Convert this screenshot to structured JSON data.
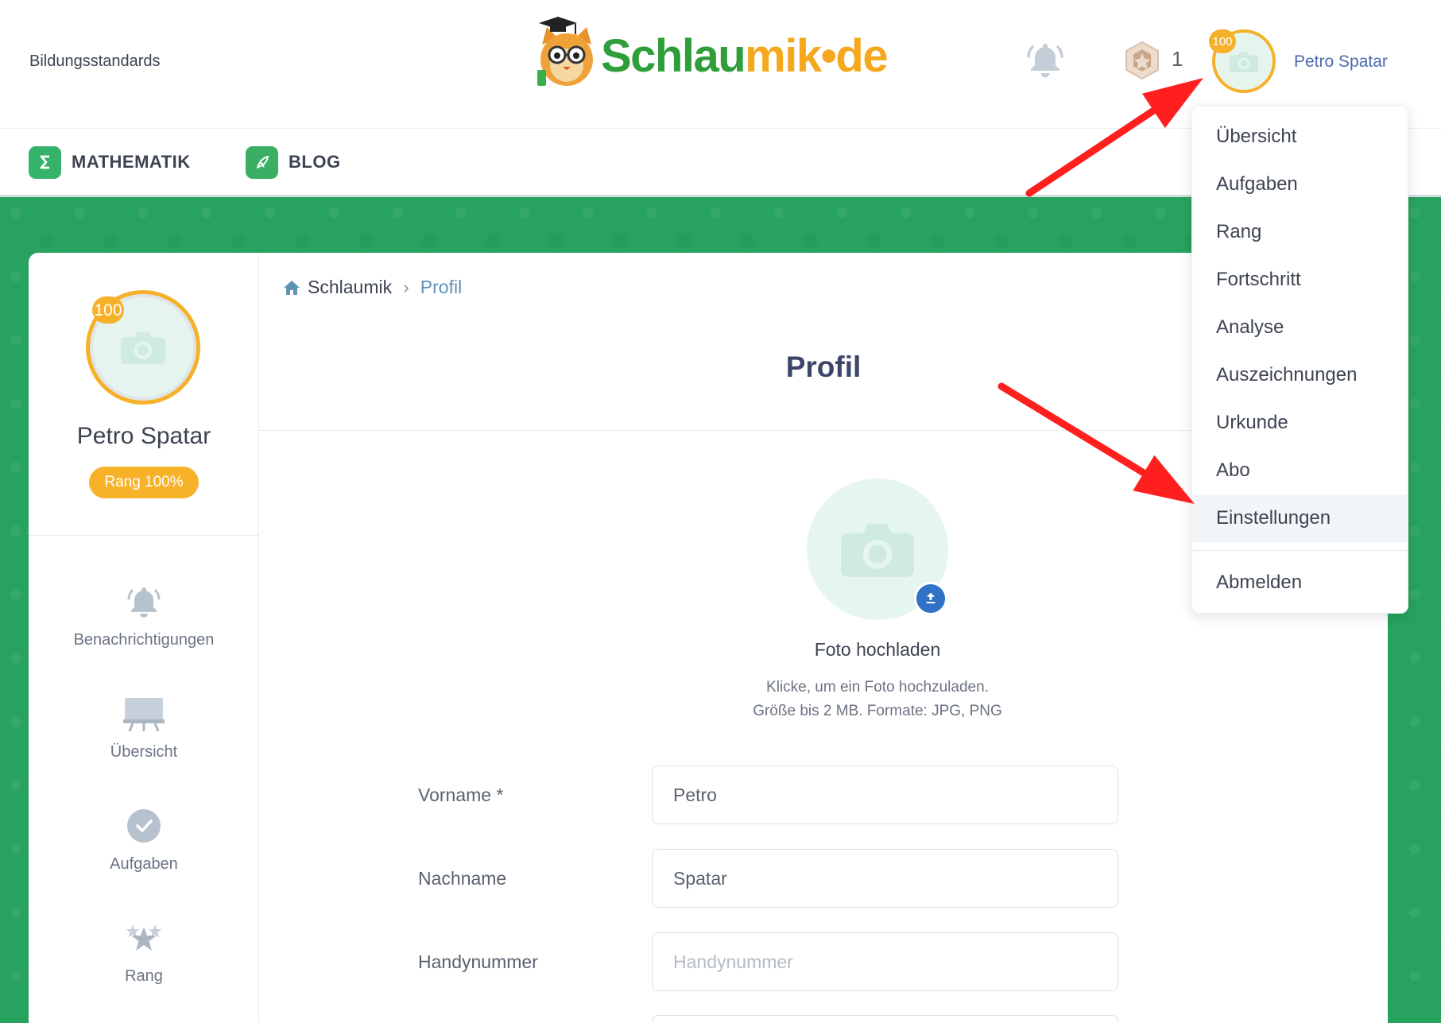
{
  "header": {
    "standards_link": "Bildungsstandards",
    "logo": {
      "part_green": "Schlau",
      "part_orange": "mik•de"
    },
    "notifications_icon": "bell-icon",
    "achievement_icon": "hexagon-badge-icon",
    "achievement_count": "1",
    "avatar": {
      "level": "100",
      "icon": "camera-icon"
    },
    "user_name": "Petro Spatar"
  },
  "nav": {
    "items": [
      {
        "label": "MATHEMATIK",
        "icon": "sigma-icon"
      },
      {
        "label": "BLOG",
        "icon": "blog-feather-icon"
      }
    ]
  },
  "user_menu": {
    "items": [
      {
        "label": "Übersicht"
      },
      {
        "label": "Aufgaben"
      },
      {
        "label": "Rang"
      },
      {
        "label": "Fortschritt"
      },
      {
        "label": "Analyse"
      },
      {
        "label": "Auszeichnungen"
      },
      {
        "label": "Urkunde"
      },
      {
        "label": "Abo"
      },
      {
        "label": "Einstellungen",
        "highlighted": true
      }
    ],
    "logout": "Abmelden"
  },
  "sidebar": {
    "avatar": {
      "level": "100",
      "icon": "camera-icon"
    },
    "name": "Petro Spatar",
    "rank_badge": "Rang 100%",
    "items": [
      {
        "label": "Benachrichtigungen",
        "icon": "bell-icon"
      },
      {
        "label": "Übersicht",
        "icon": "board-icon"
      },
      {
        "label": "Aufgaben",
        "icon": "check-circle-icon"
      },
      {
        "label": "Rang",
        "icon": "stars-icon"
      }
    ]
  },
  "breadcrumb": {
    "home_icon": "home-icon",
    "home": "Schlaumik",
    "separator": "›",
    "current": "Profil"
  },
  "page_title": "Profil",
  "photo_upload": {
    "icon": "camera-icon",
    "button_icon": "upload-icon",
    "title": "Foto hochladen",
    "hint_line1": "Klicke, um ein Foto hochzuladen.",
    "hint_line2": "Größe bis 2 MB. Formate: JPG, PNG"
  },
  "form": {
    "fields": [
      {
        "label": "Vorname *",
        "value": "Petro"
      },
      {
        "label": "Nachname",
        "value": "Spatar"
      },
      {
        "label": "Handynummer",
        "placeholder": "Handynummer"
      }
    ]
  },
  "colors": {
    "brand_green": "#27a35f",
    "accent_orange": "#f5b12a",
    "user_link_blue": "#4a6aab",
    "breadcrumb_blue": "#5f92b5",
    "upload_blue": "#2f72c6",
    "annotation_red": "#ff1f1f"
  }
}
